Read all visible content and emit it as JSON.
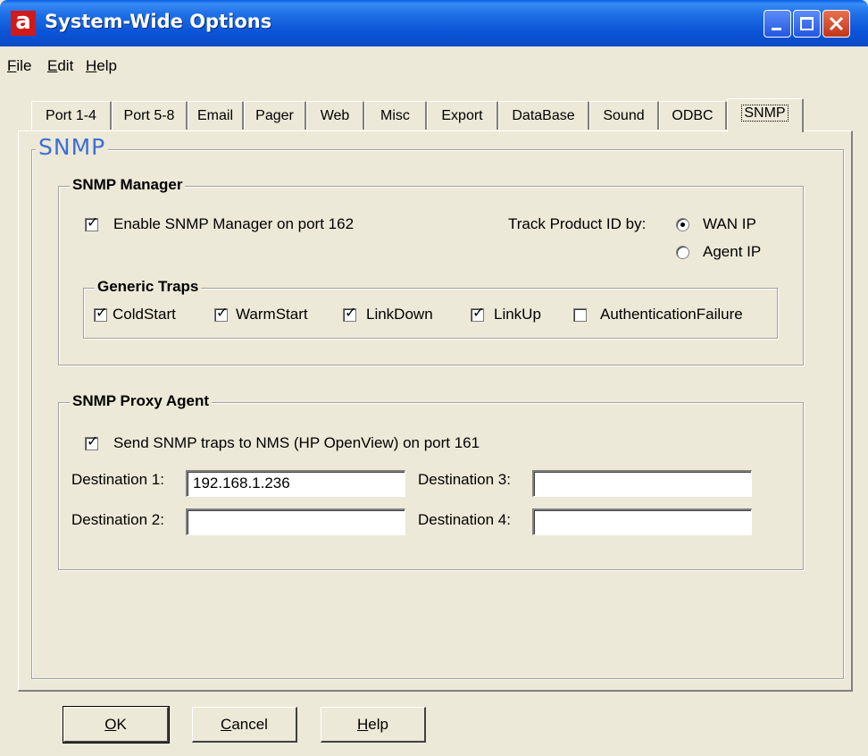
{
  "window": {
    "title": "System-Wide Options",
    "app_icon": "a",
    "controls": [
      "minimize-icon",
      "maximize-icon",
      "close-icon"
    ]
  },
  "menu": {
    "file_prefix": "",
    "file_u": "F",
    "file_rest": "ile",
    "edit_u": "E",
    "edit_rest": "dit",
    "help_u": "H",
    "help_rest": "elp"
  },
  "tabs": [
    "Port 1-4",
    "Port 5-8",
    "Email",
    "Pager",
    "Web",
    "Misc",
    "Export",
    "DataBase",
    "Sound",
    "ODBC",
    "SNMP"
  ],
  "active_tab": "SNMP",
  "panel": {
    "title": "SNMP",
    "manager": {
      "title": "SNMP Manager",
      "enable_label": "Enable SNMP Manager on port 162",
      "enable_checked": true,
      "track_label": "Track Product ID by:",
      "radio_wan": "WAN IP",
      "radio_agent": "Agent IP",
      "selected": "WAN IP",
      "traps": {
        "title": "Generic Traps",
        "items": [
          {
            "label": "ColdStart",
            "checked": true
          },
          {
            "label": "WarmStart",
            "checked": true
          },
          {
            "label": "LinkDown",
            "checked": true
          },
          {
            "label": "LinkUp",
            "checked": true
          },
          {
            "label": "AuthenticationFailure",
            "checked": false
          }
        ]
      }
    },
    "proxy": {
      "title": "SNMP Proxy Agent",
      "send_label": "Send SNMP traps to NMS (HP OpenView) on port 161",
      "send_checked": true,
      "dest1_label": "Destination 1:",
      "dest1_value": "192.168.1.236",
      "dest2_label": "Destination 2:",
      "dest2_value": "",
      "dest3_label": "Destination 3:",
      "dest3_value": "",
      "dest4_label": "Destination 4:",
      "dest4_value": ""
    }
  },
  "buttons": {
    "ok_u": "O",
    "ok_rest": "K",
    "cancel_u": "C",
    "cancel_rest": "ancel",
    "help_u": "H",
    "help_rest": "elp"
  },
  "colors": {
    "titlebar": "#0b53d6",
    "face": "#ece9d8",
    "panel_title": "#3c6fd6"
  }
}
